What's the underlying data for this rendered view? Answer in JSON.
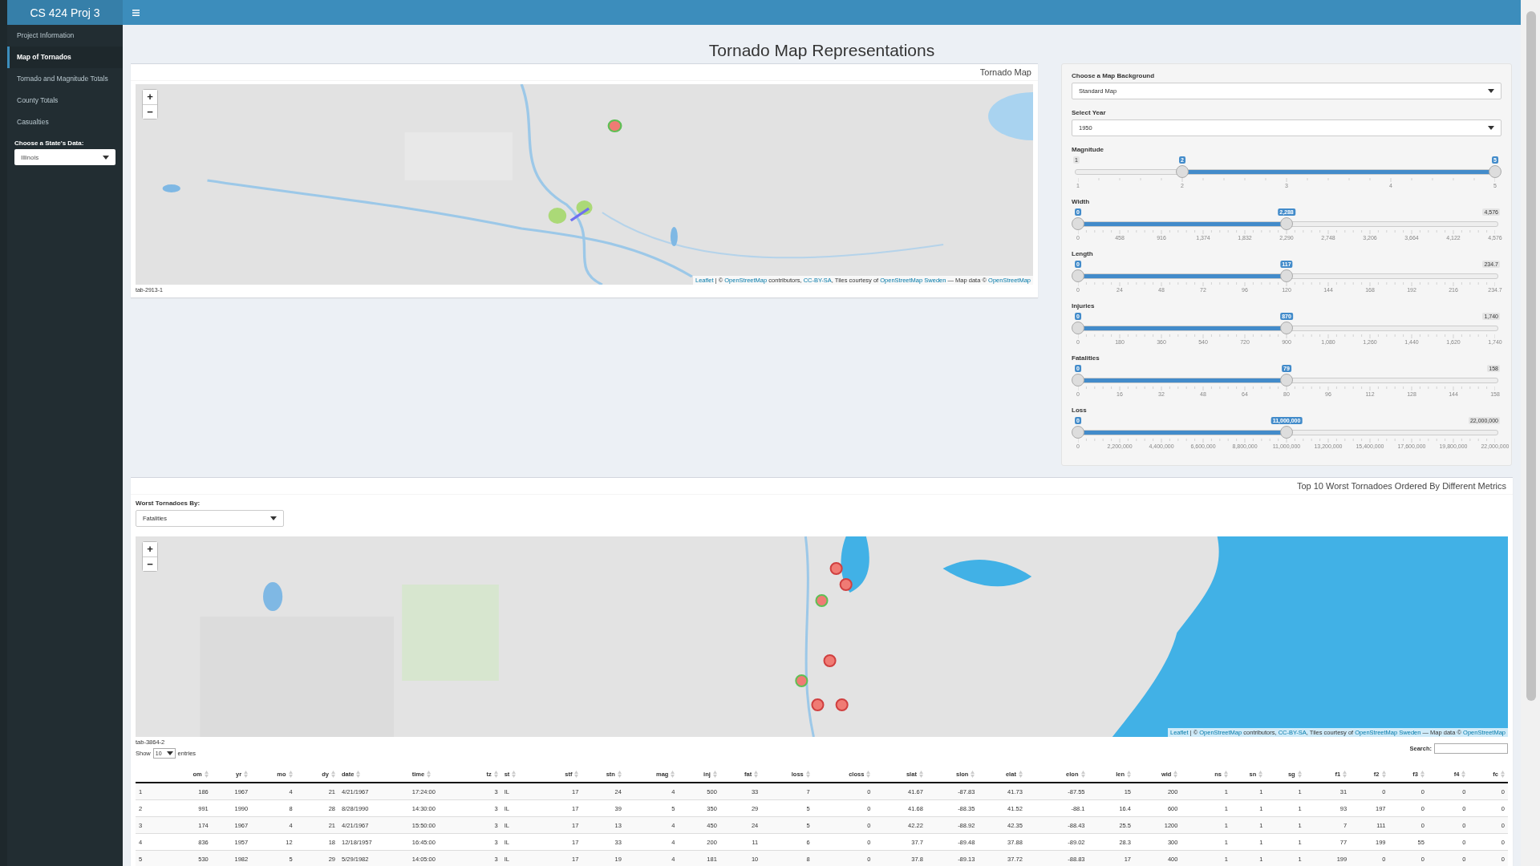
{
  "header": {
    "title": "CS 424 Proj 3"
  },
  "sidebar": {
    "items": [
      {
        "label": "Project Information",
        "selected": false
      },
      {
        "label": "Map of Tornados",
        "selected": true
      },
      {
        "label": "Tornado and Magnitude Totals",
        "selected": false
      },
      {
        "label": "County Totals",
        "selected": false
      },
      {
        "label": "Casualties",
        "selected": false
      }
    ],
    "state_select": {
      "label": "Choose a State's Data:",
      "value": "Illinois"
    }
  },
  "page_title": "Tornado Map Representations",
  "map_box": {
    "title": "Tornado Map",
    "tab_label": "tab-2913-1",
    "map": {
      "kind": "picture",
      "zoom_in": "+",
      "zoom_out": "−",
      "attribution": [
        {
          "text": "Leaflet",
          "kind": "link"
        },
        {
          "text": " | © ",
          "kind": "text"
        },
        {
          "text": "OpenStreetMap",
          "kind": "link"
        },
        {
          "text": " contributors, ",
          "kind": "text"
        },
        {
          "text": "CC-BY-SA",
          "kind": "link"
        },
        {
          "text": ", Tiles courtesy of ",
          "kind": "text"
        },
        {
          "text": "OpenStreetMap Sweden",
          "kind": "link"
        },
        {
          "text": " — Map data © ",
          "kind": "text"
        },
        {
          "text": "OpenStreetMap",
          "kind": "link"
        }
      ]
    }
  },
  "controls": {
    "background_select": {
      "label": "Choose a Map Background",
      "value": "Standard Map"
    },
    "year_select": {
      "label": "Select Year",
      "value": "1950"
    },
    "sliders": [
      {
        "label": "Magnitude",
        "min_label": "1",
        "handles": [
          {
            "label": "2",
            "level": 0.25
          },
          {
            "label": "5",
            "level": 1
          }
        ],
        "ticks": [
          "1",
          "2",
          "3",
          "4",
          "5"
        ]
      },
      {
        "label": "Width",
        "max_label": "4,576",
        "handles": [
          {
            "label": "0",
            "level": 0
          },
          {
            "label": "2,288",
            "level": 0.5
          }
        ],
        "ticks": [
          "0",
          "458",
          "916",
          "1,374",
          "1,832",
          "2,290",
          "2,748",
          "3,206",
          "3,664",
          "4,122",
          "4,576"
        ]
      },
      {
        "label": "Length",
        "max_label": "234.7",
        "handles": [
          {
            "label": "0",
            "level": 0
          },
          {
            "label": "117",
            "level": 0.5
          }
        ],
        "ticks": [
          "0",
          "24",
          "48",
          "72",
          "96",
          "120",
          "144",
          "168",
          "192",
          "216",
          "234.7"
        ]
      },
      {
        "label": "Injuries",
        "max_label": "1,740",
        "handles": [
          {
            "label": "0",
            "level": 0
          },
          {
            "label": "870",
            "level": 0.5
          }
        ],
        "ticks": [
          "0",
          "180",
          "360",
          "540",
          "720",
          "900",
          "1,080",
          "1,260",
          "1,440",
          "1,620",
          "1,740"
        ]
      },
      {
        "label": "Fatalities",
        "max_label": "158",
        "handles": [
          {
            "label": "0",
            "level": 0
          },
          {
            "label": "79",
            "level": 0.5
          }
        ],
        "ticks": [
          "0",
          "16",
          "32",
          "48",
          "64",
          "80",
          "96",
          "112",
          "128",
          "144",
          "158"
        ]
      },
      {
        "label": "Loss",
        "max_label": "22,000,000",
        "handles": [
          {
            "label": "0",
            "level": 0
          },
          {
            "label": "11,000,000",
            "level": 0.5
          }
        ],
        "ticks": [
          "0",
          "2,200,000",
          "4,400,000",
          "6,600,000",
          "8,800,000",
          "11,000,000",
          "13,200,000",
          "15,400,000",
          "17,600,000",
          "19,800,000",
          "22,000,000"
        ]
      }
    ]
  },
  "worst_box": {
    "title": "Top 10 Worst Tornadoes Ordered By Different Metrics",
    "metric_select": {
      "label": "Worst Tornadoes By:",
      "value": "Fatalities"
    },
    "map": {
      "kind": "picture",
      "zoom_in": "+",
      "zoom_out": "−",
      "attribution": [
        {
          "text": "Leaflet",
          "kind": "link"
        },
        {
          "text": " | © ",
          "kind": "text"
        },
        {
          "text": "OpenStreetMap",
          "kind": "link"
        },
        {
          "text": " contributors, ",
          "kind": "text"
        },
        {
          "text": "CC-BY-SA",
          "kind": "link"
        },
        {
          "text": ", Tiles courtesy of ",
          "kind": "text"
        },
        {
          "text": "OpenStreetMap Sweden",
          "kind": "link"
        },
        {
          "text": " — Map data © ",
          "kind": "text"
        },
        {
          "text": "OpenStreetMap",
          "kind": "link"
        }
      ]
    },
    "tab_label": "tab-3864-2",
    "length_control": {
      "prefix": "Show",
      "value": "10",
      "suffix": "entries"
    },
    "search": {
      "label": "Search:"
    },
    "table": {
      "columns": [
        "",
        "om",
        "yr",
        "mo",
        "dy",
        "date",
        "time",
        "tz",
        "st",
        "stf",
        "stn",
        "mag",
        "inj",
        "fat",
        "loss",
        "closs",
        "slat",
        "slon",
        "elat",
        "elon",
        "len",
        "wid",
        "ns",
        "sn",
        "sg",
        "f1",
        "f2",
        "f3",
        "f4",
        "fc"
      ],
      "rows": [
        [
          "1",
          "186",
          "1967",
          "4",
          "21",
          "4/21/1967",
          "17:24:00",
          "3",
          "IL",
          "17",
          "24",
          "4",
          "500",
          "33",
          "7",
          "0",
          "41.67",
          "-87.83",
          "41.73",
          "-87.55",
          "15",
          "200",
          "1",
          "1",
          "1",
          "31",
          "0",
          "0",
          "0",
          "0"
        ],
        [
          "2",
          "991",
          "1990",
          "8",
          "28",
          "8/28/1990",
          "14:30:00",
          "3",
          "IL",
          "17",
          "39",
          "5",
          "350",
          "29",
          "5",
          "0",
          "41.68",
          "-88.35",
          "41.52",
          "-88.1",
          "16.4",
          "600",
          "1",
          "1",
          "1",
          "93",
          "197",
          "0",
          "0",
          "0"
        ],
        [
          "3",
          "174",
          "1967",
          "4",
          "21",
          "4/21/1967",
          "15:50:00",
          "3",
          "IL",
          "17",
          "13",
          "4",
          "450",
          "24",
          "5",
          "0",
          "42.22",
          "-88.92",
          "42.35",
          "-88.43",
          "25.5",
          "1200",
          "1",
          "1",
          "1",
          "7",
          "111",
          "0",
          "0",
          "0"
        ],
        [
          "4",
          "836",
          "1957",
          "12",
          "18",
          "12/18/1957",
          "16:45:00",
          "3",
          "IL",
          "17",
          "33",
          "4",
          "200",
          "11",
          "6",
          "0",
          "37.7",
          "-89.48",
          "37.88",
          "-89.02",
          "28.3",
          "300",
          "1",
          "1",
          "1",
          "77",
          "199",
          "55",
          "0",
          "0"
        ],
        [
          "5",
          "530",
          "1982",
          "5",
          "29",
          "5/29/1982",
          "14:05:00",
          "3",
          "IL",
          "17",
          "19",
          "4",
          "181",
          "10",
          "8",
          "0",
          "37.8",
          "-89.13",
          "37.72",
          "-88.83",
          "17",
          "400",
          "1",
          "1",
          "1",
          "199",
          "0",
          "0",
          "0",
          "0"
        ]
      ]
    }
  }
}
